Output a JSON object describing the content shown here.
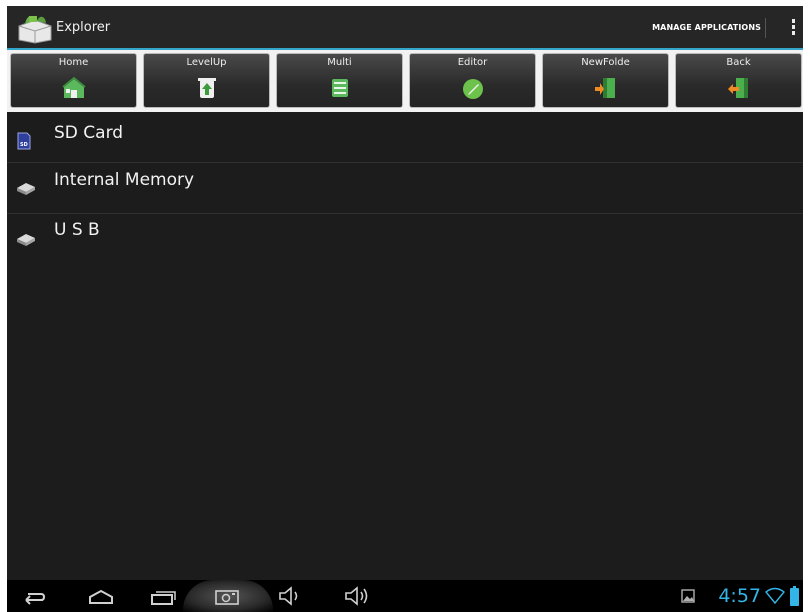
{
  "app": {
    "title": "Explorer",
    "manage_label": "MANAGE APPLICATIONS",
    "icon": "explorer-app-icon"
  },
  "toolbar": [
    {
      "label": "Home",
      "icon": "home-icon"
    },
    {
      "label": "LevelUp",
      "icon": "levelup-icon"
    },
    {
      "label": "Multi",
      "icon": "multi-icon"
    },
    {
      "label": "Editor",
      "icon": "editor-icon"
    },
    {
      "label": "NewFolde",
      "icon": "new-folder-icon"
    },
    {
      "label": "Back",
      "icon": "back-icon"
    }
  ],
  "storage": [
    {
      "label": "SD Card",
      "icon": "sd-card-icon"
    },
    {
      "label": "Internal Memory",
      "icon": "drive-icon"
    },
    {
      "label": "U S B",
      "icon": "drive-icon"
    }
  ],
  "status": {
    "time": "4:57"
  },
  "colors": {
    "accent": "#33b5e5",
    "background": "#1c1c1c",
    "toolbar_bg": "#f2f2f2"
  }
}
